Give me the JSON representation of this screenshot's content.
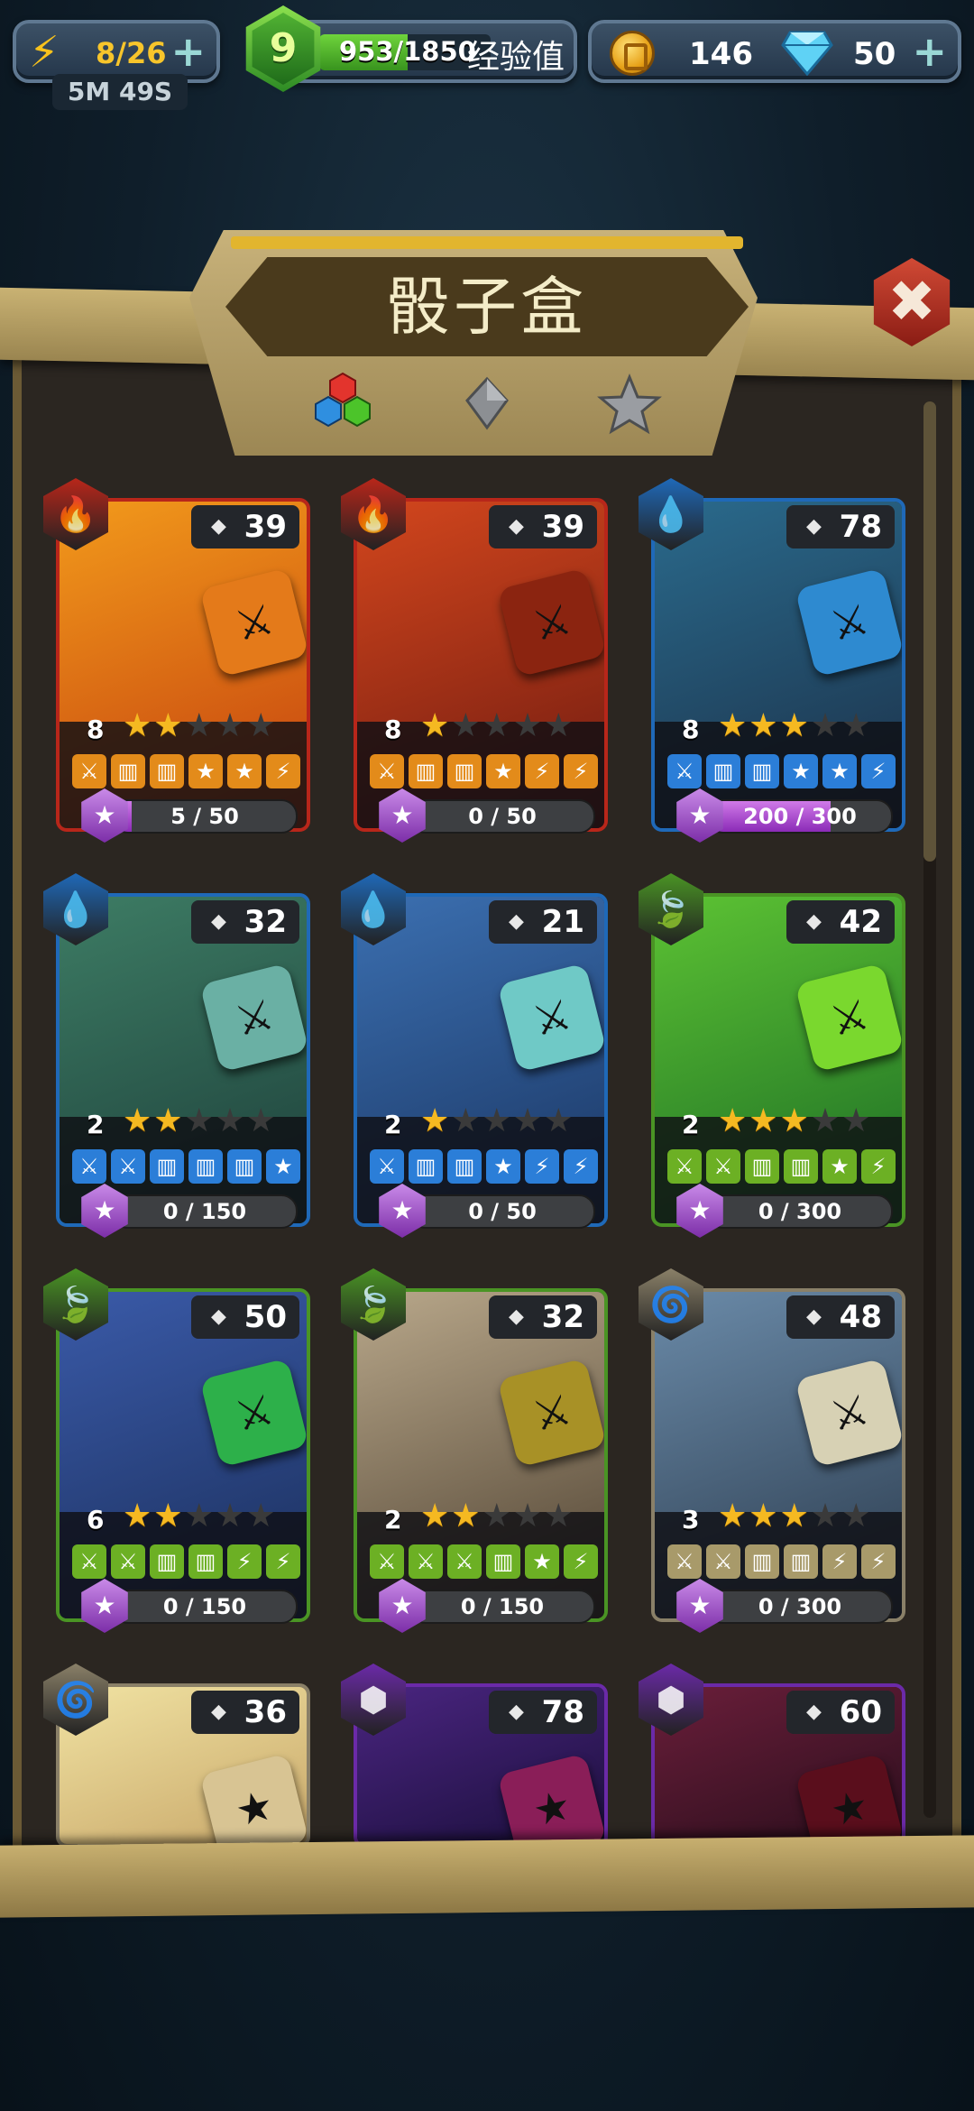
{
  "hud": {
    "energy": "8/26",
    "energy_timer": "5M 49S",
    "level": "9",
    "xp": "953/1850",
    "xp_fraction": 0.515,
    "xp_label": "经验值",
    "coins": "146",
    "gems": "50"
  },
  "panel": {
    "title": "骰子盒"
  },
  "colors": {
    "fire": "#b8261a",
    "water": "#1f69b8",
    "nature": "#4a9424",
    "air": "#8a8068",
    "arcane": "#6b2aa8"
  },
  "cards": [
    {
      "element": "fire",
      "icon": "🔥",
      "cost": "39",
      "level": "8",
      "stars": 2,
      "faces": [
        "⚔",
        "▥",
        "▥",
        "★",
        "★",
        "⚡"
      ],
      "progress": "5 / 50",
      "progress_value": 0.1,
      "art": [
        "#f29a1b",
        "#c33e0e"
      ],
      "die": "#e47a1a"
    },
    {
      "element": "fire",
      "icon": "🔥",
      "cost": "39",
      "level": "8",
      "stars": 1,
      "faces": [
        "⚔",
        "▥",
        "▥",
        "★",
        "⚡",
        "⚡"
      ],
      "progress": "0 / 50",
      "progress_value": 0,
      "art": [
        "#d2461d",
        "#6e1a10"
      ],
      "die": "#8b2410"
    },
    {
      "element": "water",
      "icon": "💧",
      "cost": "78",
      "level": "8",
      "stars": 3,
      "faces": [
        "⚔",
        "▥",
        "▥",
        "★",
        "★",
        "⚡"
      ],
      "progress": "200 / 300",
      "progress_value": 0.667,
      "art": [
        "#2a6a8c",
        "#1b2f47"
      ],
      "die": "#2e8ad0"
    },
    {
      "element": "water",
      "icon": "💧",
      "cost": "32",
      "level": "2",
      "stars": 2,
      "faces": [
        "⚔",
        "⚔",
        "▥",
        "▥",
        "▥",
        "★"
      ],
      "progress": "0 / 150",
      "progress_value": 0,
      "art": [
        "#3d7c64",
        "#1d3f3a"
      ],
      "die": "#6ab0a4"
    },
    {
      "element": "water",
      "icon": "💧",
      "cost": "21",
      "level": "2",
      "stars": 1,
      "faces": [
        "⚔",
        "▥",
        "▥",
        "★",
        "⚡",
        "⚡"
      ],
      "progress": "0 / 50",
      "progress_value": 0,
      "art": [
        "#3b6fb0",
        "#1a3562"
      ],
      "die": "#6fc9c6"
    },
    {
      "element": "nature",
      "icon": "🍃",
      "cost": "42",
      "level": "2",
      "stars": 3,
      "faces": [
        "⚔",
        "⚔",
        "▥",
        "▥",
        "★",
        "⚡"
      ],
      "progress": "0 / 300",
      "progress_value": 0,
      "art": [
        "#5cc233",
        "#1b6b25"
      ],
      "die": "#7ad82e"
    },
    {
      "element": "nature",
      "icon": "🍃",
      "cost": "50",
      "level": "6",
      "stars": 2,
      "faces": [
        "⚔",
        "⚔",
        "▥",
        "▥",
        "⚡",
        "⚡"
      ],
      "progress": "0 / 150",
      "progress_value": 0,
      "art": [
        "#3a5aa8",
        "#1a2e5a"
      ],
      "die": "#2db04a"
    },
    {
      "element": "nature",
      "icon": "🍃",
      "cost": "32",
      "level": "2",
      "stars": 2,
      "faces": [
        "⚔",
        "⚔",
        "⚔",
        "▥",
        "★",
        "⚡"
      ],
      "progress": "0 / 150",
      "progress_value": 0,
      "art": [
        "#b8a78a",
        "#4d4030"
      ],
      "die": "#a89126"
    },
    {
      "element": "air",
      "icon": "🌀",
      "cost": "48",
      "level": "3",
      "stars": 3,
      "faces": [
        "⚔",
        "⚔",
        "▥",
        "▥",
        "⚡",
        "⚡"
      ],
      "progress": "0 / 300",
      "progress_value": 0,
      "art": [
        "#6a8aa8",
        "#2a3a4c"
      ],
      "die": "#d7d1b4"
    },
    {
      "element": "air",
      "icon": "🌀",
      "cost": "36",
      "level": "",
      "stars": 0,
      "faces": [],
      "progress": "",
      "progress_value": 0,
      "art": [
        "#f0e2a2",
        "#c9a86a"
      ],
      "die": "#d8c493"
    },
    {
      "element": "arcane",
      "icon": "⬢",
      "cost": "78",
      "level": "",
      "stars": 0,
      "faces": [],
      "progress": "",
      "progress_value": 0,
      "art": [
        "#4a2580",
        "#1b0f3c"
      ],
      "die": "#8a1e58"
    },
    {
      "element": "arcane",
      "icon": "⬢",
      "cost": "60",
      "level": "",
      "stars": 0,
      "faces": [],
      "progress": "",
      "progress_value": 0,
      "art": [
        "#6a1e3a",
        "#2a0e1c"
      ],
      "die": "#5a0e1c"
    }
  ]
}
